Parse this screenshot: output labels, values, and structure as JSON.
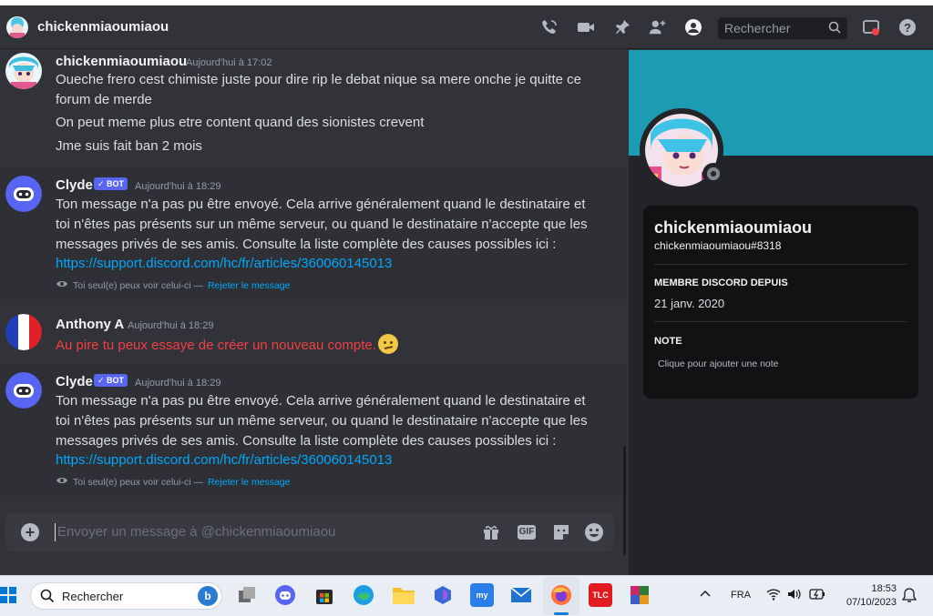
{
  "header": {
    "title": "chickenmiaoumiaou",
    "search_placeholder": "Rechercher"
  },
  "messages": [
    {
      "author": "chickenmiaoumiaou",
      "timestamp": "Aujourd'hui à 17:02",
      "lines": [
        "Oueche frero cest chimiste juste pour dire rip le debat nique sa mere onche je quitte ce",
        "forum de merde",
        "On peut meme plus etre content quand des sionistes crevent",
        "Jme suis fait ban 2 mois"
      ]
    },
    {
      "author": "Clyde",
      "badge": "BOT",
      "timestamp": "Aujourd'hui à 18:29",
      "lines": [
        "Ton message n'a pas pu être envoyé. Cela arrive généralement quand le destinataire et",
        "toi n'êtes pas présents sur un même serveur, ou quand le destinataire n'accepte que les",
        "messages privés de ses amis. Consulte la liste complète des causes possibles ici :"
      ],
      "link": "https://support.discord.com/hc/fr/articles/360060145013",
      "ephemeral": "Toi seul(e) peux voir celui-ci —",
      "dismiss": "Rejeter le message"
    },
    {
      "author": "Anthony A",
      "timestamp": "Aujourd'hui à 18:29",
      "lines": [
        "Au pire tu peux essaye de créer un nouveau compte."
      ]
    },
    {
      "author": "Clyde",
      "badge": "BOT",
      "timestamp": "Aujourd'hui à 18:29",
      "lines": [
        "Ton message n'a pas pu être envoyé. Cela arrive généralement quand le destinataire et",
        "toi n'êtes pas présents sur un même serveur, ou quand le destinataire n'accepte que les",
        "messages privés de ses amis. Consulte la liste complète des causes possibles ici :"
      ],
      "link": "https://support.discord.com/hc/fr/articles/360060145013",
      "ephemeral": "Toi seul(e) peux voir celui-ci —",
      "dismiss": "Rejeter le message"
    }
  ],
  "composer": {
    "placeholder": "Envoyer un message à @chickenmiaoumiaou",
    "gif_label": "GIF"
  },
  "profile": {
    "display_name": "chickenmiaoumiaou",
    "username": "chickenmiaoumiaou#8318",
    "member_since_label": "MEMBRE DISCORD DEPUIS",
    "member_since": "21 janv. 2020",
    "note_label": "NOTE",
    "note_placeholder": "Clique pour ajouter une note",
    "banner_color": "#1d9bb3"
  },
  "taskbar": {
    "search_label": "Rechercher",
    "language": "FRA",
    "time": "18:53",
    "date": "07/10/2023",
    "apps": [
      "task-view",
      "discord",
      "store",
      "edge",
      "file-explorer",
      "copilot",
      "mybp",
      "mail",
      "firefox",
      "tlc",
      "winrar"
    ]
  },
  "colors": {
    "background": "#313338",
    "link": "#00a8fc",
    "bot_badge": "#5865f2",
    "error_text": "#f23f43"
  }
}
